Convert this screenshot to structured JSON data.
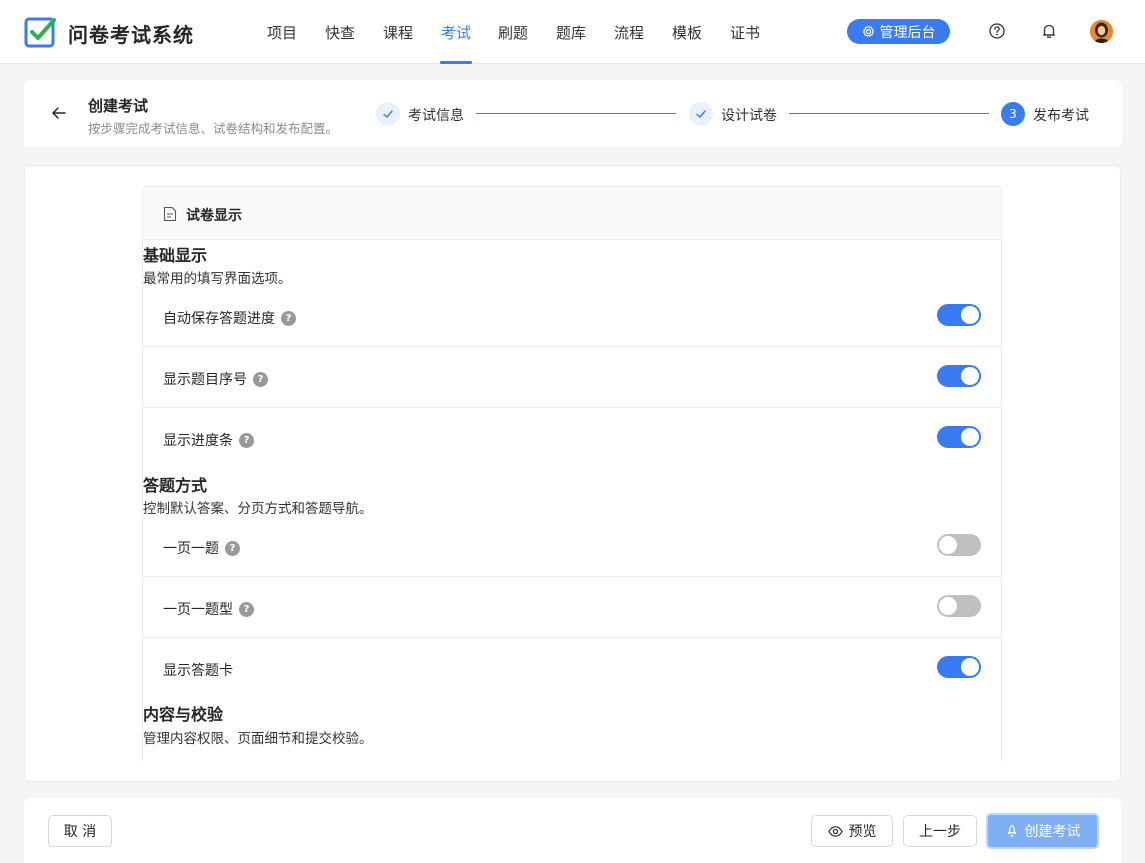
{
  "brand": {
    "name": "问卷考试系统"
  },
  "nav": {
    "items": [
      "项目",
      "快查",
      "课程",
      "考试",
      "刷题",
      "题库",
      "流程",
      "模板",
      "证书"
    ],
    "active_index": 3,
    "admin_label": "管理后台"
  },
  "header": {
    "title": "创建考试",
    "subtitle": "按步骤完成考试信息、试卷结构和发布配置。",
    "steps": [
      {
        "label": "考试信息",
        "status": "done"
      },
      {
        "label": "设计试卷",
        "status": "done"
      },
      {
        "label": "发布考试",
        "status": "current",
        "number": "3"
      }
    ]
  },
  "panel": {
    "title": "试卷显示",
    "sections": [
      {
        "title": "基础显示",
        "desc": "最常用的填写界面选项。",
        "rows": [
          {
            "label": "自动保存答题进度",
            "help": true,
            "on": true
          },
          {
            "label": "显示题目序号",
            "help": true,
            "on": true
          },
          {
            "label": "显示进度条",
            "help": true,
            "on": true
          }
        ]
      },
      {
        "title": "答题方式",
        "desc": "控制默认答案、分页方式和答题导航。",
        "rows": [
          {
            "label": "一页一题",
            "help": true,
            "on": false
          },
          {
            "label": "一页一题型",
            "help": true,
            "on": false
          },
          {
            "label": "显示答题卡",
            "help": false,
            "on": true
          }
        ]
      },
      {
        "title": "内容与校验",
        "desc": "管理内容权限、页面细节和提交校验。",
        "rows": []
      }
    ]
  },
  "footer": {
    "cancel": "取 消",
    "preview": "预览",
    "prev": "上一步",
    "create": "创建考试"
  },
  "colors": {
    "accent": "#3a7bef",
    "toggle_off": "#bfbfbf"
  }
}
